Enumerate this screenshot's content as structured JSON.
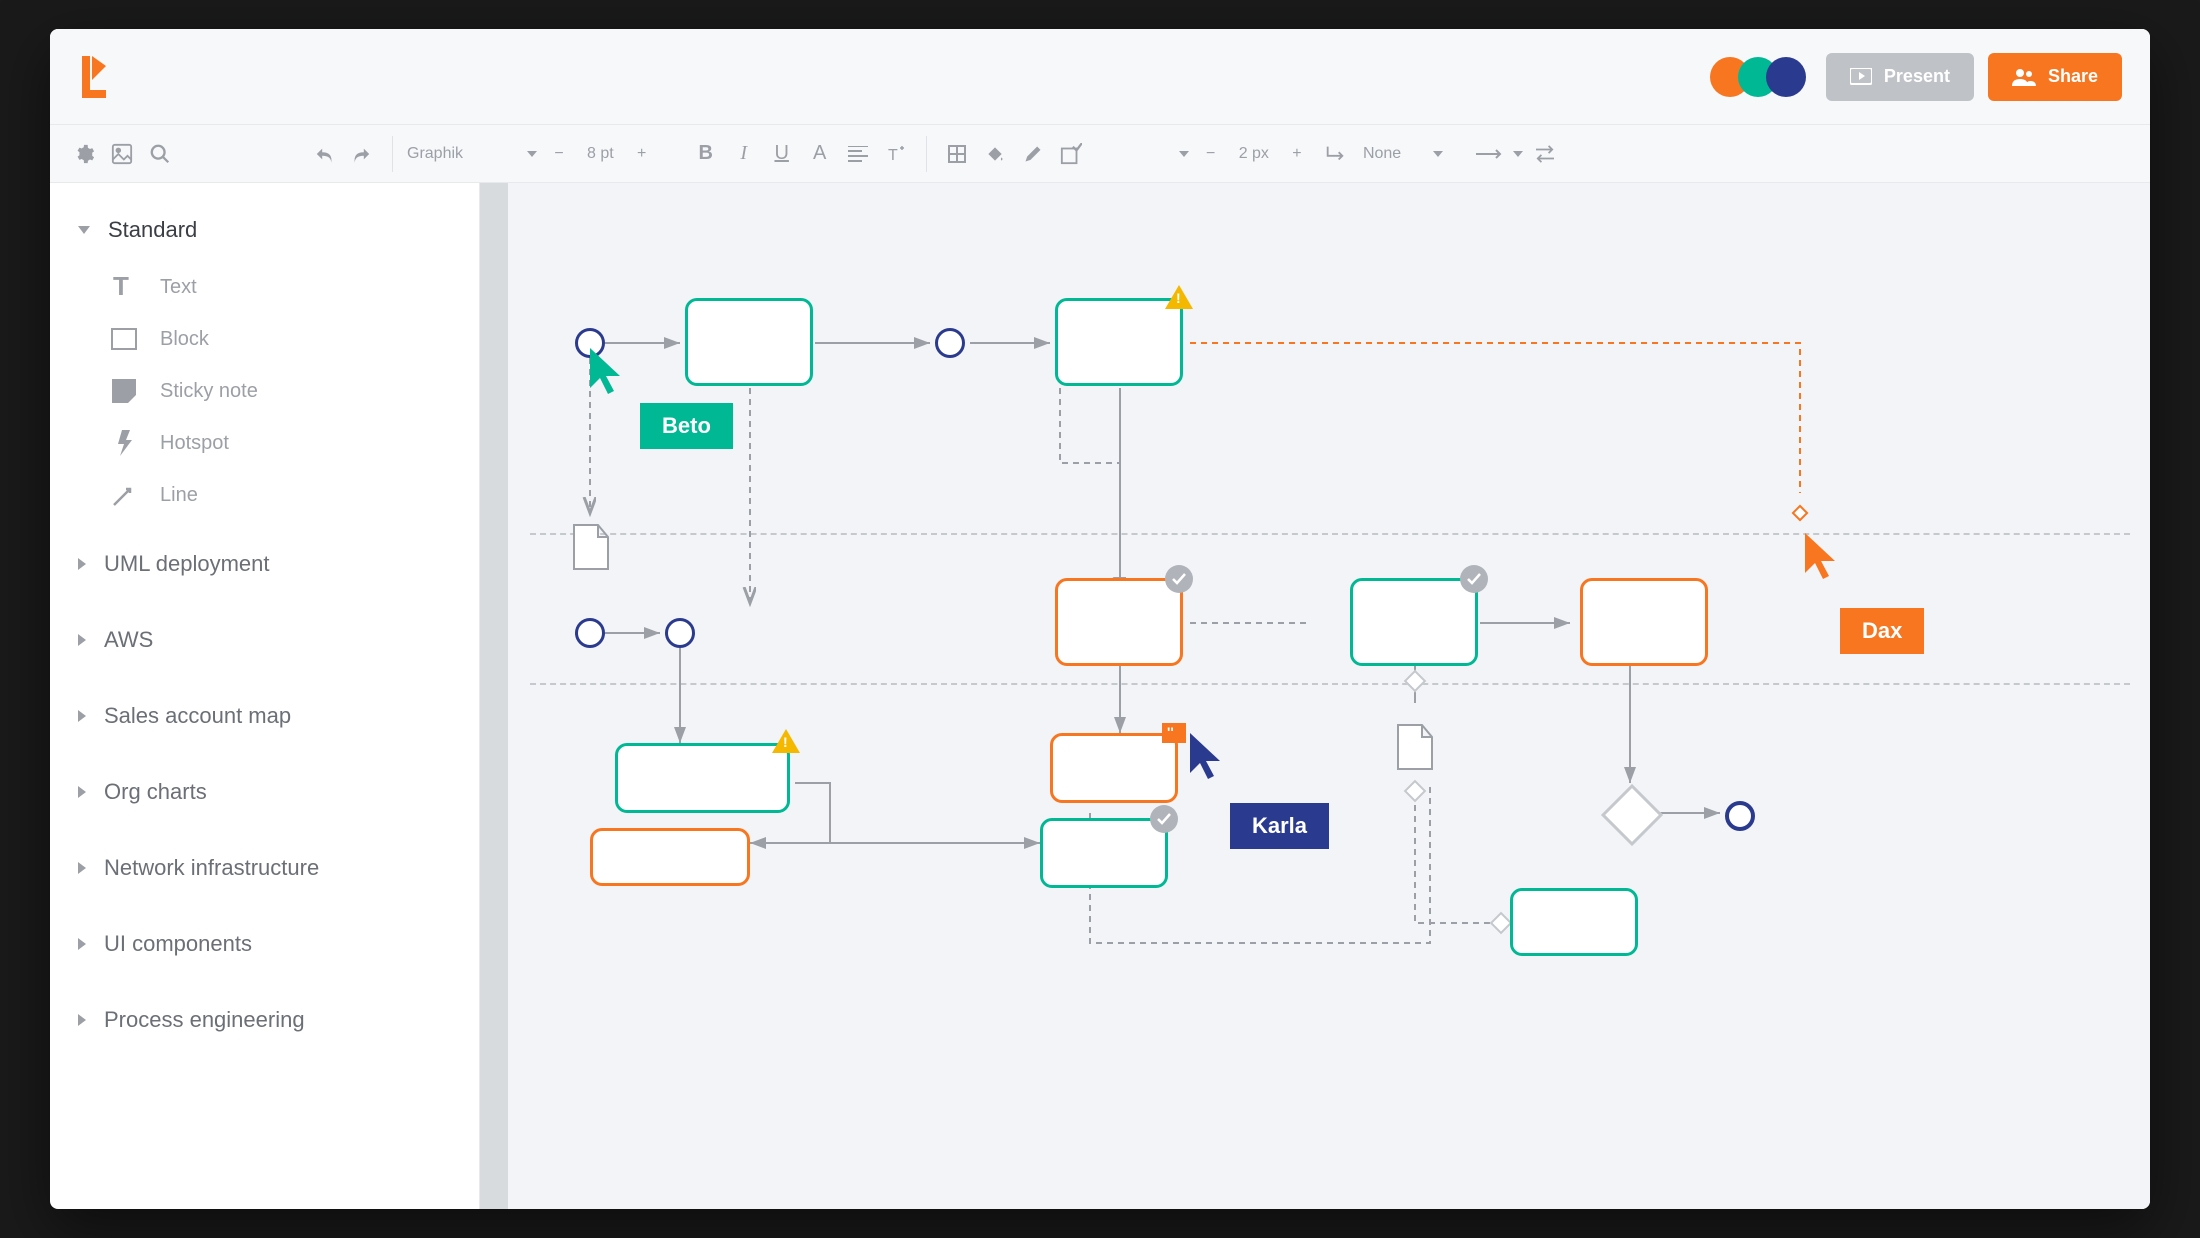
{
  "header": {
    "present_label": "Present",
    "share_label": "Share",
    "avatar_colors": [
      "#f7761f",
      "#00b894",
      "#2a3a8f"
    ]
  },
  "toolbar": {
    "font_name": "Graphik",
    "font_size": "8 pt",
    "stroke_width": "2 px",
    "line_style": "None"
  },
  "sidebar": {
    "panels": [
      {
        "label": "Standard",
        "expanded": true
      },
      {
        "label": "UML deployment",
        "expanded": false
      },
      {
        "label": "AWS",
        "expanded": false
      },
      {
        "label": "Sales account map",
        "expanded": false
      },
      {
        "label": "Org charts",
        "expanded": false
      },
      {
        "label": "Network infrastructure",
        "expanded": false
      },
      {
        "label": "UI components",
        "expanded": false
      },
      {
        "label": "Process engineering",
        "expanded": false
      }
    ],
    "standard_shapes": [
      {
        "label": "Text",
        "icon": "text"
      },
      {
        "label": "Block",
        "icon": "block"
      },
      {
        "label": "Sticky note",
        "icon": "sticky"
      },
      {
        "label": "Hotspot",
        "icon": "hotspot"
      },
      {
        "label": "Line",
        "icon": "line"
      }
    ]
  },
  "collaborators": [
    {
      "name": "Beto",
      "color": "#00b894"
    },
    {
      "name": "Karla",
      "color": "#2a3a8f"
    },
    {
      "name": "Dax",
      "color": "#f7761f"
    }
  ]
}
